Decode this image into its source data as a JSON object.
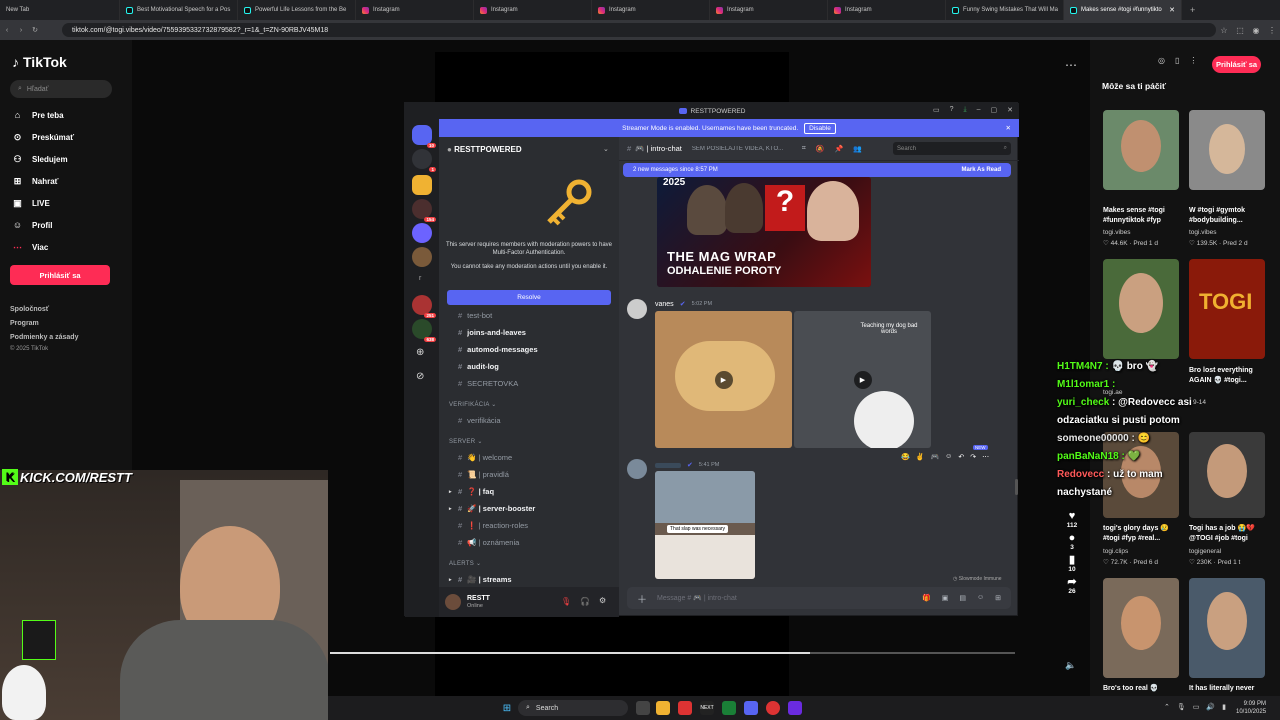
{
  "browser": {
    "tabs": [
      {
        "label": "New Tab",
        "type": "blank"
      },
      {
        "label": "Best Motivational Speech for a Pos",
        "type": "tt"
      },
      {
        "label": "Powerful Life Lessons from the Be",
        "type": "tt"
      },
      {
        "label": "Instagram",
        "type": "ig"
      },
      {
        "label": "Instagram",
        "type": "ig"
      },
      {
        "label": "Instagram",
        "type": "ig"
      },
      {
        "label": "Instagram",
        "type": "ig"
      },
      {
        "label": "Instagram",
        "type": "ig"
      },
      {
        "label": "Funny Swing Mistakes That Will Ma",
        "type": "tt"
      },
      {
        "label": "Makes sense #togi #funnytikto",
        "type": "tt",
        "active": true
      }
    ],
    "url": "tiktok.com/@togi.vibes/video/7559395332732879582?_r=1&_t=ZN-90RBJV45M18"
  },
  "tiktok": {
    "logo": "TikTok",
    "search_placeholder": "Hľadať",
    "nav": [
      "Pre teba",
      "Preskúmať",
      "Sledujem",
      "Nahrať",
      "LIVE",
      "Profil",
      "Viac"
    ],
    "login": "Prihlásiť sa",
    "footer": [
      "Spoločnosť",
      "Program",
      "Podmienky a zásady",
      "© 2025 TikTok"
    ],
    "login_right": "Prihlásiť sa",
    "may_like": "Môže sa ti páčiť",
    "cards": [
      {
        "title": "Makes sense #togi #funnytiktok #fyp",
        "user": "togi.vibes",
        "stat": "♡ 44.6K · Pred 1 d"
      },
      {
        "title": "W #togi #gymtok #bodybuilding...",
        "user": "togi.vibes",
        "stat": "♡ 139.5K · Pred 2 d"
      },
      {
        "title": "",
        "user": "togi.ae",
        "stat": ""
      },
      {
        "title": "Bro lost everything AGAIN 💀 #togi...",
        "user": "togi.ae",
        "stat": "· 9-14"
      },
      {
        "title": "togi's glory days 😢 #togi #fyp #real...",
        "user": "togi.clips",
        "stat": "♡ 72.7K · Pred 6 d"
      },
      {
        "title": "Togi has a job 😭💔 @TOGI #job #togi",
        "user": "togigeneral",
        "stat": "♡ 230K · Pred 1 t"
      },
      {
        "title": "Bro's too real 💀",
        "user": "",
        "stat": ""
      },
      {
        "title": "It has literally never",
        "user": "",
        "stat": ""
      }
    ],
    "actions": {
      "likes": "112",
      "comments": "3",
      "saves": "10",
      "shares": "26"
    }
  },
  "discord": {
    "title": "RESTTPOWERED",
    "streamer_banner": "Streamer Mode is enabled. Usernames have been truncated.",
    "disable": "Disable",
    "server_name": "RESTTPOWERED",
    "mfa_text1": "This server requires members with moderation powers to have Multi-Factor Authentication.",
    "mfa_text2": "You cannot take any moderation actions until you enable it.",
    "resolve": "Resolve",
    "channels_top": [
      "test-bot",
      "joins-and-leaves",
      "automod-messages",
      "audit-log",
      "SECRETOVKA"
    ],
    "cat_verif": "VERIFIKÁCIA",
    "verif": "verifikácia",
    "cat_server": "SERVER",
    "server_channels": [
      "👋 | welcome",
      "📜 | pravidlá",
      "❓ | faq",
      "🚀 | server-booster",
      "❗ | reaction-roles",
      "📢 | oznámenia"
    ],
    "cat_alerts": "ALERTS",
    "alerts_channels": [
      "🎥 | streams"
    ],
    "user": "RESTT",
    "user_status": "Online",
    "channel": "🎮 | intro-chat",
    "topic": "SEM POSIELAJTE VIDEÁ, KTO...",
    "search": "Search",
    "new_messages": "2 new messages since 8:57 PM",
    "mark_read": "Mark As Read",
    "thumb_text1": "THE MAG WRAP",
    "thumb_text2": "ODHALENIE POROTY",
    "thumb_year": "2025",
    "msg1_user": "vanes",
    "msg1_time": "5:02 PM",
    "video_caption": "Teaching my dog bad words",
    "msg2_time": "5:41 PM",
    "msg2_caption": "That slap was necessary",
    "new_badge": "NEW",
    "slowmode": "Slowmode Immune",
    "composer": "Message # 🎮 | intro-chat",
    "server_badges": [
      "10",
      "1",
      "154",
      "251",
      "638"
    ]
  },
  "overlay": {
    "kick": "KICK.COM/RESTT",
    "chat": [
      {
        "u": "H1TM4N7 :",
        "m": " 💀 bro 👻",
        "c": "u"
      },
      {
        "u": "M1l1omar1 :",
        "m": " ",
        "c": "u"
      },
      {
        "u": "yuri_check",
        "m": " : @Redovecc asi odzaciatku si pusti potom",
        "c": "u"
      },
      {
        "u": "someone00000 :",
        "m": " 😊",
        "c": "u3"
      },
      {
        "u": "panBaNaN18 :",
        "m": " 💚",
        "c": "u"
      },
      {
        "u": "Redovecc",
        "m": " : už to mam nachystané",
        "c": "u2"
      }
    ]
  },
  "taskbar": {
    "search": "Search",
    "time": "9:09 PM",
    "date": "10/10/2025"
  }
}
